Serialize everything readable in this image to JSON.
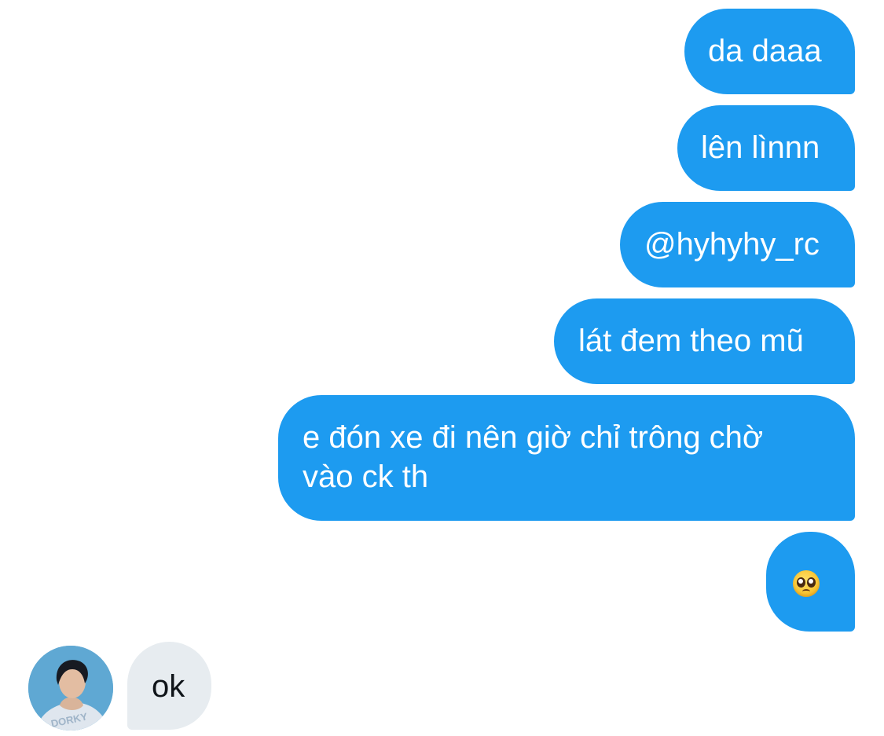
{
  "messages": {
    "sent": [
      {
        "text": "da daaa"
      },
      {
        "text": "lên lìnnn"
      },
      {
        "text": "@hyhyhy_rc"
      },
      {
        "text": "lát đem theo mũ"
      },
      {
        "text_line1": "e đón xe đi nên giờ chỉ trông chờ",
        "text_line2": "vào ck th"
      },
      {
        "emoji": "pleading-face-emoji"
      }
    ],
    "received": [
      {
        "text": "ok"
      }
    ]
  },
  "avatar": {
    "icon": "user-avatar-photo",
    "shirt_text": "DORKY"
  },
  "colors": {
    "sent_bubble": "#1d9bf0",
    "received_bubble": "#e7ecf0",
    "sent_text": "#ffffff",
    "received_text": "#0f1419"
  }
}
